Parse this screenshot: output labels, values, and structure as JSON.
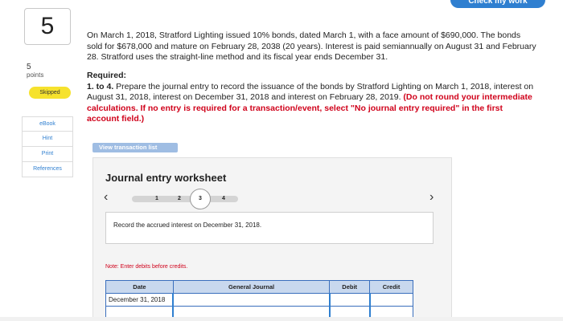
{
  "header": {
    "check_button": "Check my work"
  },
  "question": {
    "number": "5",
    "points_value": "5",
    "points_label": "points",
    "status_badge": "Skipped"
  },
  "side_links": [
    "eBook",
    "Hint",
    "Print",
    "References"
  ],
  "problem_text": "On March 1, 2018, Stratford Lighting issued 10% bonds, dated March 1, with a face amount of $690,000. The bonds sold for $678,000 and mature on February 28, 2038 (20 years). Interest is paid semiannually on August 31 and February 28. Stratford uses the straight-line method and its fiscal year ends December 31.",
  "required": {
    "title": "Required:",
    "num": "1. to 4.",
    "text": " Prepare the journal entry to record the issuance of the bonds by Stratford Lighting on March 1, 2018, interest on August 31, 2018, interest on December 31, 2018 and interest on February 28, 2019. ",
    "warning": "(Do not round your intermediate calculations. If no entry is required for a transaction/event, select \"No journal entry required\" in the first account field.)"
  },
  "view_transaction_list": "View transaction list",
  "worksheet": {
    "title": "Journal entry worksheet",
    "prev": "‹",
    "next": "›",
    "steps": [
      "1",
      "2",
      "3",
      "4"
    ],
    "active_step": "3",
    "instruction": "Record the accrued interest on December 31, 2018.",
    "note": "Note: Enter debits before credits.",
    "columns": [
      "Date",
      "General Journal",
      "Debit",
      "Credit"
    ],
    "rows": [
      {
        "date": "December 31, 2018",
        "account": "",
        "debit": "",
        "credit": ""
      }
    ]
  },
  "colors": {
    "accent": "#2f7fd0",
    "warning": "#d0021b",
    "badge": "#f6e22d",
    "table_border": "#3a6fbd",
    "table_header": "#c8d8ee"
  }
}
